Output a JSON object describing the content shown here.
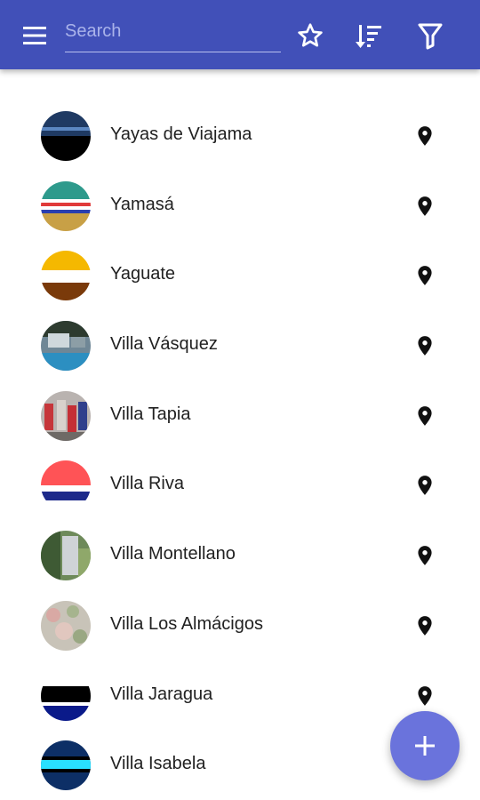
{
  "header": {
    "search_placeholder": "Search",
    "icons": [
      "menu-icon",
      "star-icon",
      "sort-icon",
      "filter-icon"
    ]
  },
  "colors": {
    "appbar": "#4150b8",
    "fab": "#6a73dc",
    "text": "#212121"
  },
  "items": [
    {
      "name": "Yayas de Viajama"
    },
    {
      "name": "Yamasá"
    },
    {
      "name": "Yaguate"
    },
    {
      "name": "Villa Vásquez"
    },
    {
      "name": "Villa Tapia"
    },
    {
      "name": "Villa Riva"
    },
    {
      "name": "Villa Montellano"
    },
    {
      "name": "Villa Los Almácigos"
    },
    {
      "name": "Villa Jaragua"
    },
    {
      "name": "Villa Isabela"
    }
  ],
  "fab": {
    "icon": "plus-icon"
  }
}
